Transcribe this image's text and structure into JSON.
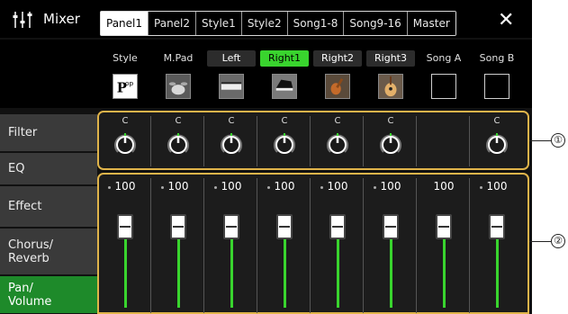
{
  "header": {
    "title": "Mixer",
    "tabs": [
      {
        "label": "Panel1",
        "active": true
      },
      {
        "label": "Panel2"
      },
      {
        "label": "Style1"
      },
      {
        "label": "Style2"
      },
      {
        "label": "Song1-8"
      },
      {
        "label": "Song9-16"
      },
      {
        "label": "Master"
      }
    ],
    "close_label": "✕"
  },
  "channels": [
    {
      "label": "Style",
      "style": "plain",
      "voice_icon": "pop-style-icon",
      "pan": "C",
      "volume": "100",
      "show_knob": true
    },
    {
      "label": "M.Pad",
      "style": "plain",
      "voice_icon": "drum-kit-icon",
      "pan": "C",
      "volume": "100",
      "show_knob": true
    },
    {
      "label": "Left",
      "style": "boxed",
      "voice_icon": "keyboard-icon",
      "pan": "C",
      "volume": "100",
      "show_knob": true
    },
    {
      "label": "Right1",
      "style": "active",
      "voice_icon": "grand-piano-icon",
      "pan": "C",
      "volume": "100",
      "show_knob": true
    },
    {
      "label": "Right2",
      "style": "boxed",
      "voice_icon": "violin-icon",
      "pan": "C",
      "volume": "100",
      "show_knob": true
    },
    {
      "label": "Right3",
      "style": "boxed",
      "voice_icon": "acoustic-guitar-icon",
      "pan": "C",
      "volume": "100",
      "show_knob": true
    },
    {
      "label": "Song A",
      "style": "plain",
      "voice_icon": "empty-voice-icon",
      "pan": "",
      "volume": "100",
      "show_knob": false
    },
    {
      "label": "Song B",
      "style": "plain",
      "voice_icon": "empty-voice-icon",
      "pan": "C",
      "volume": "100",
      "show_knob": true
    }
  ],
  "sidebar": {
    "items": [
      {
        "label": "Filter",
        "active": false
      },
      {
        "label": "EQ",
        "active": false
      },
      {
        "label": "Effect",
        "active": false
      },
      {
        "label": "Chorus/\nReverb",
        "active": false
      },
      {
        "label": "Pan/\nVolume",
        "active": true
      }
    ]
  },
  "callouts": [
    "①",
    "②"
  ],
  "colors": {
    "accent_green": "#39d42e",
    "panel_border": "#e0b44a",
    "active_sidebar": "#1e8a2a"
  }
}
